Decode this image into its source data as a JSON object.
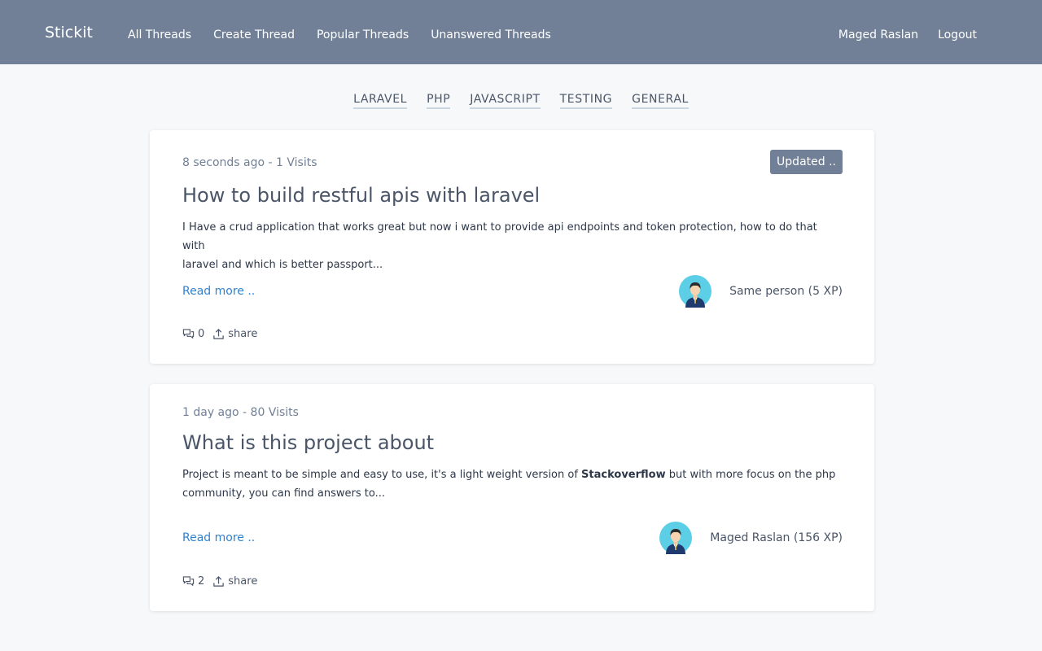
{
  "nav": {
    "brand": "Stickit",
    "links": [
      "All Threads",
      "Create Thread",
      "Popular Threads",
      "Unanswered Threads"
    ],
    "user": "Maged Raslan",
    "logout": "Logout"
  },
  "channels": [
    "LARAVEL",
    "PHP",
    "JAVASCRIPT",
    "TESTING",
    "GENERAL"
  ],
  "threads": [
    {
      "meta": "8 seconds ago - 1 Visits",
      "action_label": "Updated ..",
      "title": "How to build restful apis with laravel",
      "excerpt_line1": "I Have a crud application that works great but now i want to provide api endpoints and token protection, how to do that with",
      "excerpt_line2": "laravel and which is better passport...",
      "read_more": "Read more ..",
      "author": "Same person (5 XP)",
      "replies": "0",
      "share": "share"
    },
    {
      "meta": "1 day ago - 80 Visits",
      "title": "What is this project about",
      "excerpt_pre": "Project is meant to be simple and easy to use, it's a light weight version of ",
      "excerpt_bold": "Stackoverflow",
      "excerpt_post": " but with more focus on the php",
      "excerpt_line2": "community, you can find answers to...",
      "read_more": "Read more ..",
      "author": "Maged Raslan (156 XP)",
      "replies": "2",
      "share": "share"
    }
  ],
  "colors": {
    "navbar": "#718096",
    "link": "#3182ce",
    "page_bg": "#f7f8fa"
  },
  "icons": {
    "comments": "comments-icon",
    "share": "share-upload-icon",
    "avatar": "user-avatar-icon"
  }
}
